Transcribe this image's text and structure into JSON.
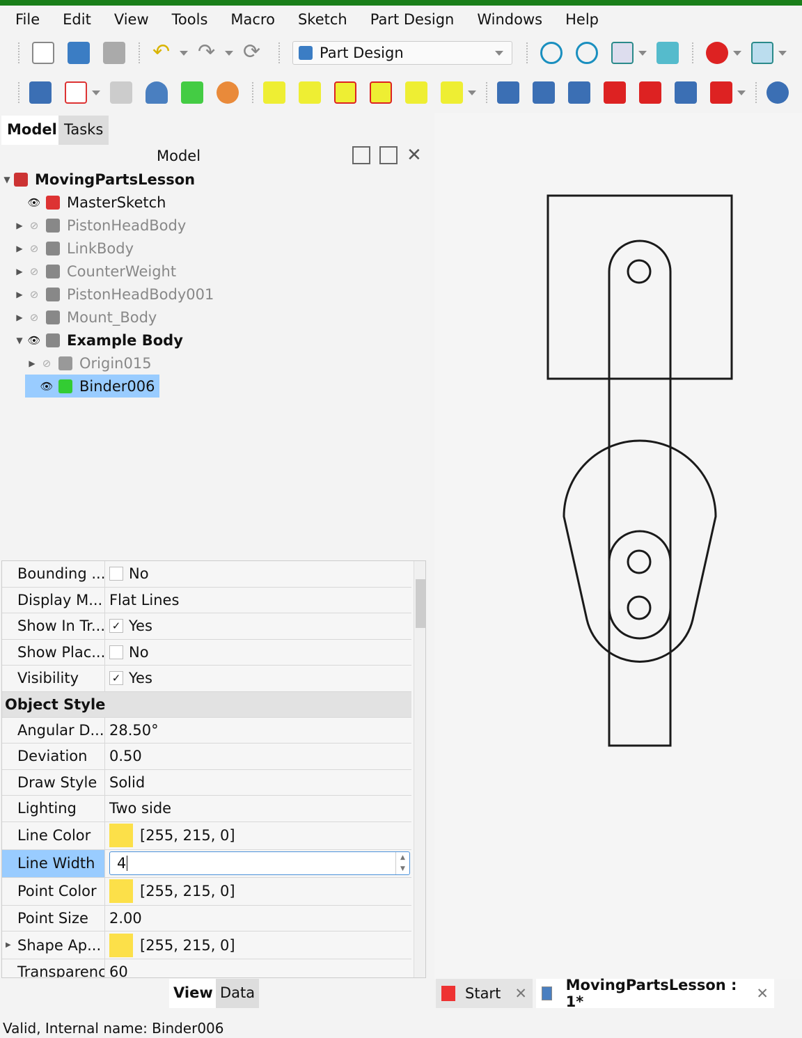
{
  "menu": [
    "File",
    "Edit",
    "View",
    "Tools",
    "Macro",
    "Sketch",
    "Part Design",
    "Windows",
    "Help"
  ],
  "toolbar": {
    "workbench": "Part Design",
    "icons_row1": [
      "new-file",
      "open-file",
      "save",
      "undo",
      "redo",
      "refresh",
      "fit-all",
      "fit-selection",
      "std-views",
      "measure",
      "draw-style",
      "view-box"
    ],
    "icons_row2": [
      "body",
      "sketch",
      "validate-sketch",
      "datum",
      "shape-binder",
      "clone",
      "pad",
      "revolution",
      "loft",
      "pipe",
      "helix",
      "additive-primitive",
      "pocket",
      "hole",
      "groove",
      "subtractive-loft",
      "subtractive-pipe",
      "subtractive-helix",
      "subtractive-primitive",
      "boolean"
    ]
  },
  "panel": {
    "tabs": [
      "Model",
      "Tasks"
    ],
    "header": "Model"
  },
  "tree": [
    {
      "label": "MovingPartsLesson",
      "bold": true,
      "level": 0,
      "expander": "open"
    },
    {
      "label": "MasterSketch",
      "level": 1,
      "visible": true
    },
    {
      "label": "PistonHeadBody",
      "level": 1,
      "hidden": true,
      "expander": "closed"
    },
    {
      "label": "LinkBody",
      "level": 1,
      "hidden": true,
      "expander": "closed"
    },
    {
      "label": "CounterWeight",
      "level": 1,
      "hidden": true,
      "expander": "closed"
    },
    {
      "label": "PistonHeadBody001",
      "level": 1,
      "hidden": true,
      "expander": "closed"
    },
    {
      "label": "Mount_Body",
      "level": 1,
      "hidden": true,
      "expander": "closed"
    },
    {
      "label": "Example Body",
      "bold": true,
      "level": 1,
      "visible": true,
      "expander": "open"
    },
    {
      "label": "Origin015",
      "level": 2,
      "hidden": true,
      "expander": "closed"
    },
    {
      "label": "Binder006",
      "level": 2,
      "visible": true,
      "selected": true
    }
  ],
  "props": {
    "rows": [
      {
        "k": "Bounding ...",
        "v": "No",
        "check": false
      },
      {
        "k": "Display M...",
        "v": "Flat Lines"
      },
      {
        "k": "Show In Tr...",
        "v": "Yes",
        "check": true
      },
      {
        "k": "Show Plac...",
        "v": "No",
        "check": false
      },
      {
        "k": "Visibility",
        "v": "Yes",
        "check": true
      }
    ],
    "group": "Object Style",
    "rows2": [
      {
        "k": "Angular D...",
        "v": "28.50°"
      },
      {
        "k": "Deviation",
        "v": "0.50"
      },
      {
        "k": "Draw Style",
        "v": "Solid"
      },
      {
        "k": "Lighting",
        "v": "Two side"
      },
      {
        "k": "Line Color",
        "v": "[255, 215, 0]",
        "color": "#ffd700"
      },
      {
        "k": "Line Width",
        "v": "4",
        "editing": true
      },
      {
        "k": "Point Color",
        "v": "[255, 215, 0]",
        "color": "#ffd700"
      },
      {
        "k": "Point Size",
        "v": "2.00"
      },
      {
        "k": "Shape Ap...",
        "v": "[255, 215, 0]",
        "color": "#ffd700"
      },
      {
        "k": "Transparency",
        "v": "60"
      }
    ],
    "tabs": [
      "View",
      "Data"
    ]
  },
  "doc_tabs": [
    {
      "label": "Start"
    },
    {
      "label": "MovingPartsLesson : 1*",
      "active": true
    }
  ],
  "status": "Valid, Internal name: Binder006",
  "colors": {
    "selection": "#99ccff",
    "accent": "#1a7f1a"
  }
}
